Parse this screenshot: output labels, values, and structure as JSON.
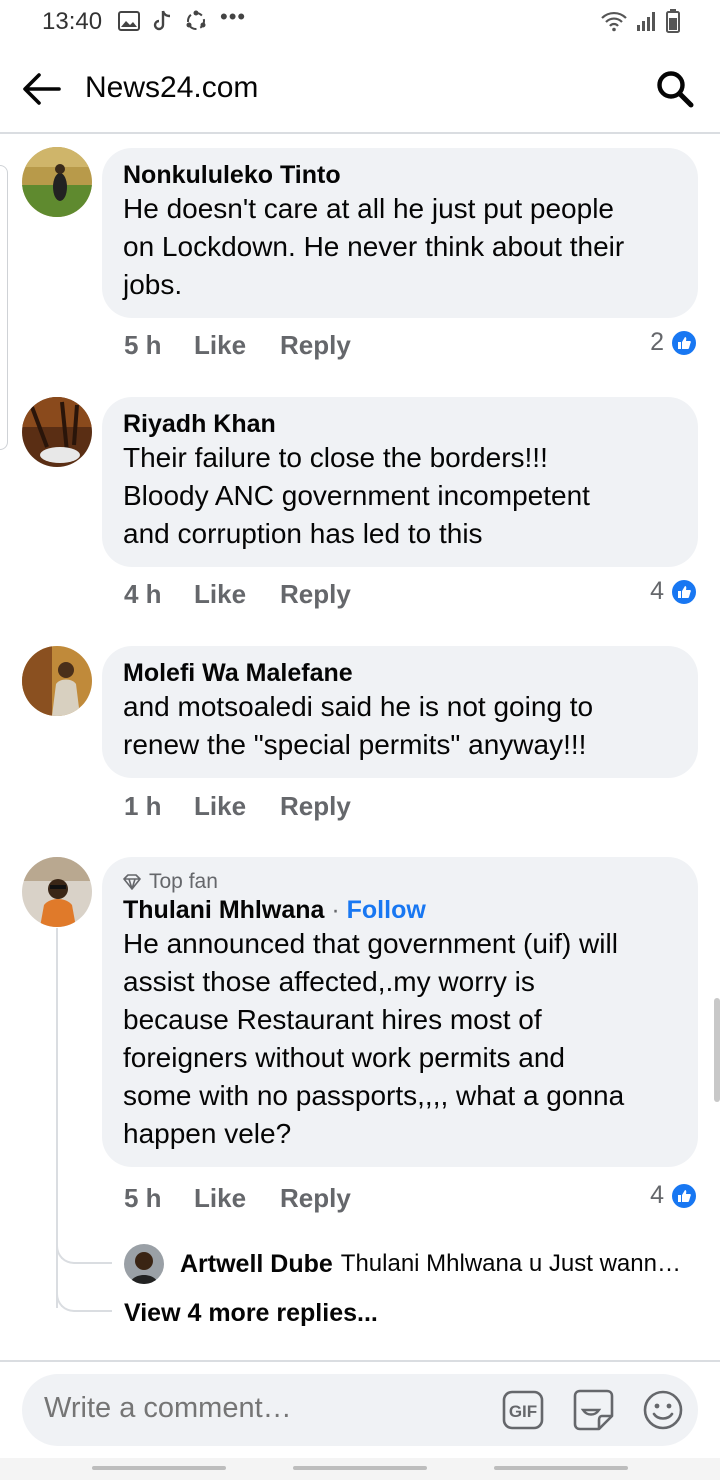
{
  "status_bar": {
    "time": "13:40",
    "left_icons": [
      "gallery-icon",
      "tiktok-icon",
      "sync-icon"
    ],
    "more_indicator": "•••",
    "right_icons": [
      "wifi-icon",
      "signal-icon",
      "battery-icon"
    ]
  },
  "header": {
    "title": "News24.com",
    "back_icon": "arrow-left-icon",
    "search_icon": "search-icon"
  },
  "comments": [
    {
      "author": "Nonkululeko Tinto",
      "lines": [
        "He doesn't care at all he just put people",
        "on Lockdown. He never think about their",
        "jobs."
      ],
      "time": "5 h",
      "like_label": "Like",
      "reply_label": "Reply",
      "reactions": "2"
    },
    {
      "author": "Riyadh Khan",
      "lines": [
        "Their failure to close the borders!!!",
        "Bloody ANC government incompetent",
        "and corruption has led to this"
      ],
      "time": "4 h",
      "like_label": "Like",
      "reply_label": "Reply",
      "reactions": "4"
    },
    {
      "author": "Molefi Wa Malefane",
      "lines": [
        "and motsoaledi said he is not going to",
        "renew the \"special permits\" anyway!!!"
      ],
      "time": "1 h",
      "like_label": "Like",
      "reply_label": "Reply",
      "reactions": ""
    },
    {
      "badge": "Top fan",
      "author": "Thulani Mhlwana",
      "separator": "·",
      "follow_label": "Follow",
      "lines": [
        "He announced that government (uif) will",
        "assist those affected,.my worry is",
        "because Restaurant hires most of",
        "foreigners without work permits and",
        "some with no passports,,,, what a gonna",
        "happen vele?"
      ],
      "time": "5 h",
      "like_label": "Like",
      "reply_label": "Reply",
      "reactions": "4"
    }
  ],
  "reply_preview": {
    "author": "Artwell Dube",
    "text": "Thulani Mhlwana u Just wann…"
  },
  "view_more": "View 4 more replies...",
  "composer": {
    "placeholder": "Write a comment…",
    "gif_label": "GIF",
    "icons": [
      "gif-icon",
      "sticker-icon",
      "emoji-icon"
    ]
  },
  "colors": {
    "accent": "#1877f2",
    "bubble": "#f0f2f5",
    "meta_text": "#65676b"
  }
}
